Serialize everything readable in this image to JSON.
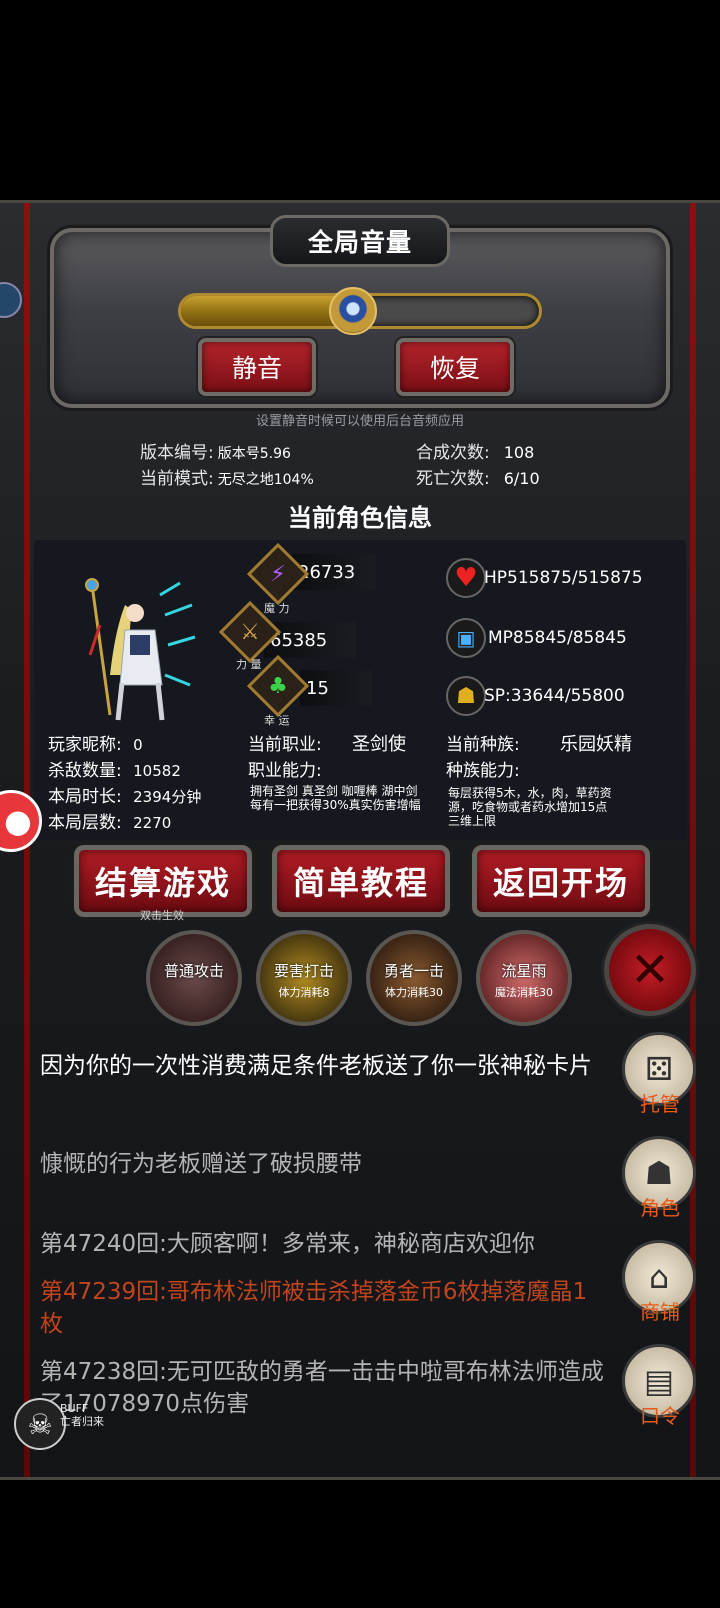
{
  "volume": {
    "title": "全局音量",
    "level": 0.48,
    "mute_label": "静音",
    "restore_label": "恢复",
    "hint": "设置静音时候可以使用后台音频应用"
  },
  "game_stats": {
    "version_label": "版本编号:",
    "version_value": "版本号5.96",
    "mode_label": "当前模式:",
    "mode_value": "无尽之地104%",
    "craft_label": "合成次数:",
    "craft_value": "108",
    "death_label": "死亡次数:",
    "death_value": "6/10"
  },
  "character": {
    "section_title": "当前角色信息",
    "magic_value": "26733",
    "magic_caption": "魔 力",
    "power_value": "65385",
    "power_caption": "力 量",
    "luck_value": "15",
    "luck_caption": "幸 运",
    "hp": "HP515875/515875",
    "mp": "MP85845/85845",
    "sp": "SP:33644/55800",
    "nickname_label": "玩家昵称:",
    "nickname_value": "0",
    "kills_label": "杀敌数量:",
    "kills_value": "10582",
    "duration_label": "本局时长:",
    "duration_value": "2394分钟",
    "floors_label": "本局层数:",
    "floors_value": "2270",
    "job_label": "当前职业:",
    "job_value": "圣剑使",
    "job_ability_label": "职业能力:",
    "job_ability_text": "拥有圣剑 真圣剑 咖喱棒 湖中剑每有一把获得30%真实伤害增幅",
    "race_label": "当前种族:",
    "race_value": "乐园妖精",
    "race_ability_label": "种族能力:",
    "race_ability_text": "每层获得5木，水，肉，草药资源，吃食物或者药水增加15点三维上限"
  },
  "actions": {
    "settle_label": "结算游戏",
    "settle_sub": "双击生效",
    "tutorial_label": "简单教程",
    "return_label": "返回开场"
  },
  "skills": [
    {
      "name": "普通攻击",
      "cost": ""
    },
    {
      "name": "要害打击",
      "cost": "体力消耗8"
    },
    {
      "name": "勇者一击",
      "cost": "体力消耗30"
    },
    {
      "name": "流星雨",
      "cost": "魔法消耗30"
    }
  ],
  "log": [
    {
      "text": "因为你的一次性消费满足条件老板送了你一张神秘卡片",
      "color": "#ffffff"
    },
    {
      "text": "慷慨的行为老板赠送了破损腰带",
      "color": "#b4b4b4"
    },
    {
      "text": "第47240回:大顾客啊！多常来，神秘商店欢迎你",
      "color": "#b4b4b4"
    },
    {
      "text": "第47239回:哥布林法师被击杀掉落金币6枚掉落魔晶1枚",
      "color": "#c0441c"
    },
    {
      "text": "第47238回:无可匹敌的勇者一击击中啦哥布林法师造成了17078970点伤害",
      "color": "#b4b4b4"
    }
  ],
  "side_menu": [
    {
      "label": "托管",
      "icon": "dice-icon"
    },
    {
      "label": "角色",
      "icon": "hooded-figure-icon"
    },
    {
      "label": "商铺",
      "icon": "shop-icon"
    },
    {
      "label": "口令",
      "icon": "scroll-icon"
    }
  ],
  "buff": {
    "title": "BUFF",
    "name": "亡者归来"
  },
  "colors": {
    "accent_red": "#b21c24",
    "gold": "#b08a2e",
    "log_highlight": "#c0441c"
  }
}
